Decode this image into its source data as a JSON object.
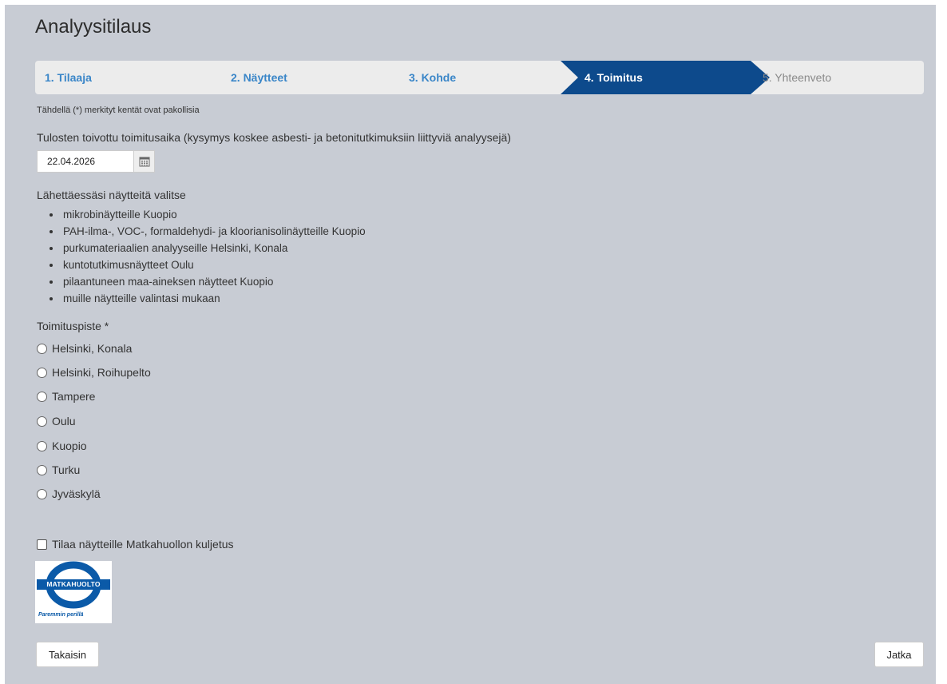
{
  "page": {
    "title": "Analyysitilaus"
  },
  "stepper": {
    "steps": [
      {
        "label": "1. Tilaaja",
        "state": "done"
      },
      {
        "label": "2. Näytteet",
        "state": "done"
      },
      {
        "label": "3. Kohde",
        "state": "done"
      },
      {
        "label": "4. Toimitus",
        "state": "active"
      },
      {
        "label": "5. Yhteenveto",
        "state": "future"
      }
    ],
    "active_color": "#0d4a8c"
  },
  "form": {
    "required_note": "Tähdellä (*) merkityt kentät ovat pakollisia",
    "delivery_time_label": "Tulosten toivottu toimitusaika (kysymys koskee asbesti- ja betonitutkimuksiin liittyviä analyysejä)",
    "delivery_date_value": "22.04.2026",
    "calendar_icon": "calendar-icon",
    "intro": "Lähettäessäsi näytteitä valitse",
    "bullets": [
      "mikrobinäytteille Kuopio",
      "PAH-ilma-, VOC-, formaldehydi- ja kloorianisolinäytteille Kuopio",
      "purkumateriaalien analyyseille Helsinki, Konala",
      "kuntotutkimusnäytteet Oulu",
      "pilaantuneen maa-aineksen näytteet Kuopio",
      "muille näytteille valintasi mukaan"
    ],
    "location_label": "Toimituspiste *",
    "locations": [
      "Helsinki, Konala",
      "Helsinki, Roihupelto",
      "Tampere",
      "Oulu",
      "Kuopio",
      "Turku",
      "Jyväskylä"
    ],
    "matkahuolto_checkbox_label": "Tilaa näytteille Matkahuollon kuljetus",
    "matkahuolto_checked": false,
    "logo": {
      "name": "MATKAHUOLTO",
      "slogan": "Paremmin perillä",
      "color": "#0b5aa8"
    }
  },
  "buttons": {
    "back": "Takaisin",
    "next": "Jatka"
  }
}
